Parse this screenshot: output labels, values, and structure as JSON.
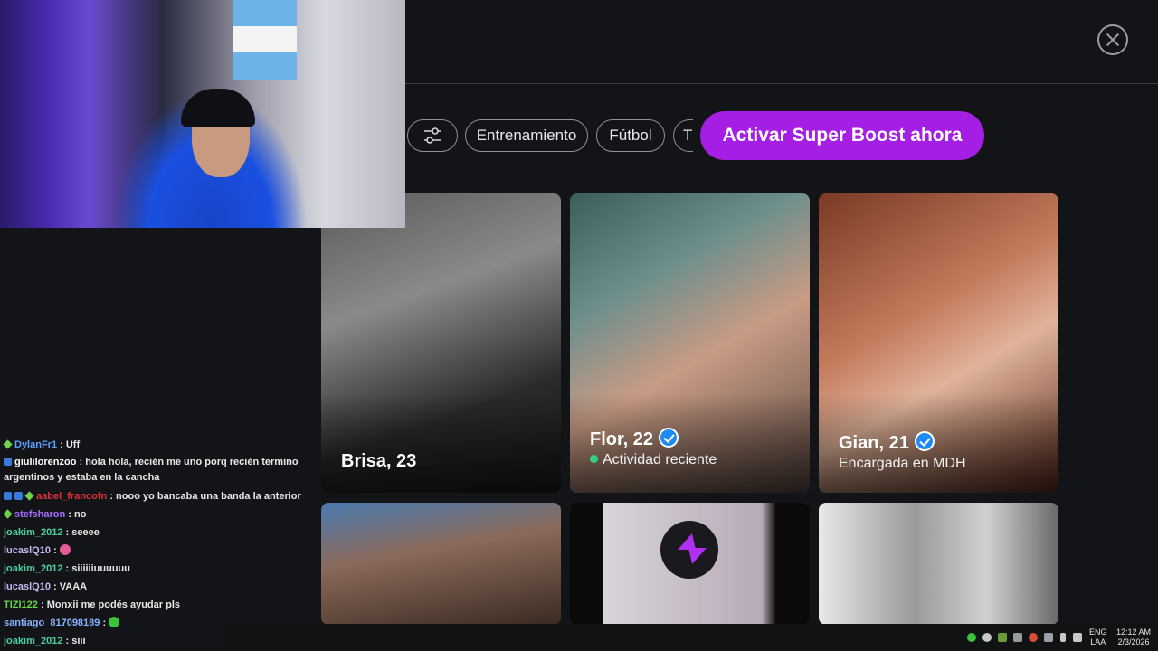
{
  "app": {
    "filters": {
      "chips": [
        "Entrenamiento",
        "Fútbol",
        "T"
      ],
      "boost_label": "Activar Super Boost ahora"
    },
    "cards": [
      {
        "name": "Brisa, 23",
        "verified": false,
        "subtitle": ""
      },
      {
        "name": "Flor, 22",
        "verified": true,
        "subtitle": "Actividad reciente",
        "online": true
      },
      {
        "name": "Gian, 21",
        "verified": true,
        "subtitle": "Encargada en MDH"
      }
    ],
    "colors": {
      "boost": "#a51ee3",
      "verified": "#1d8bf1",
      "online": "#35d07f"
    }
  },
  "chat": [
    {
      "user": "DylanFr1",
      "color": "#5aa0ff",
      "badges": [
        "green"
      ],
      "text": ": Uff"
    },
    {
      "user": "giulilorenzoo",
      "color": "#ffffff",
      "badges": [
        "blue"
      ],
      "text": ": hola hola, recién me uno porq recién termino argentinos y estaba en la cancha"
    },
    {
      "user": "aabel_francofn",
      "color": "#e0303a",
      "badges": [
        "blue",
        "blue",
        "green"
      ],
      "text": ": nooo yo bancaba una banda la anterior"
    },
    {
      "user": "stefsharon",
      "color": "#a66cff",
      "badges": [
        "green"
      ],
      "text": ": no"
    },
    {
      "user": "joakim_2012",
      "color": "#4ad0a0",
      "badges": [],
      "text": ": seeee"
    },
    {
      "user": "lucaslQ10",
      "color": "#c6b8f0",
      "badges": [],
      "text": ":",
      "emote": "#e85a9a"
    },
    {
      "user": "joakim_2012",
      "color": "#4ad0a0",
      "badges": [],
      "text": ": siiiiiiuuuuuu"
    },
    {
      "user": "lucaslQ10",
      "color": "#c6b8f0",
      "badges": [],
      "text": ": VAAA"
    },
    {
      "user": "TIZI122",
      "color": "#6cd44a",
      "badges": [],
      "text": ": Monxii me podés ayudar pls"
    },
    {
      "user": "santiago_817098189",
      "color": "#8ab4ff",
      "badges": [],
      "text": ":",
      "emote": "#3ac43a"
    },
    {
      "user": "joakim_2012",
      "color": "#4ad0a0",
      "badges": [],
      "text": ": siii"
    }
  ],
  "taskbar": {
    "lang_top": "ENG",
    "lang_bottom": "LAA",
    "time": "12:12 AM",
    "date": "2/3/2026",
    "tray_icons": [
      "whatsapp-icon",
      "network-icon",
      "app-icon",
      "app-icon",
      "chrome-icon",
      "app-icon",
      "microphone-icon",
      "keyboard-icon",
      "display-icon",
      "volume-icon"
    ]
  }
}
